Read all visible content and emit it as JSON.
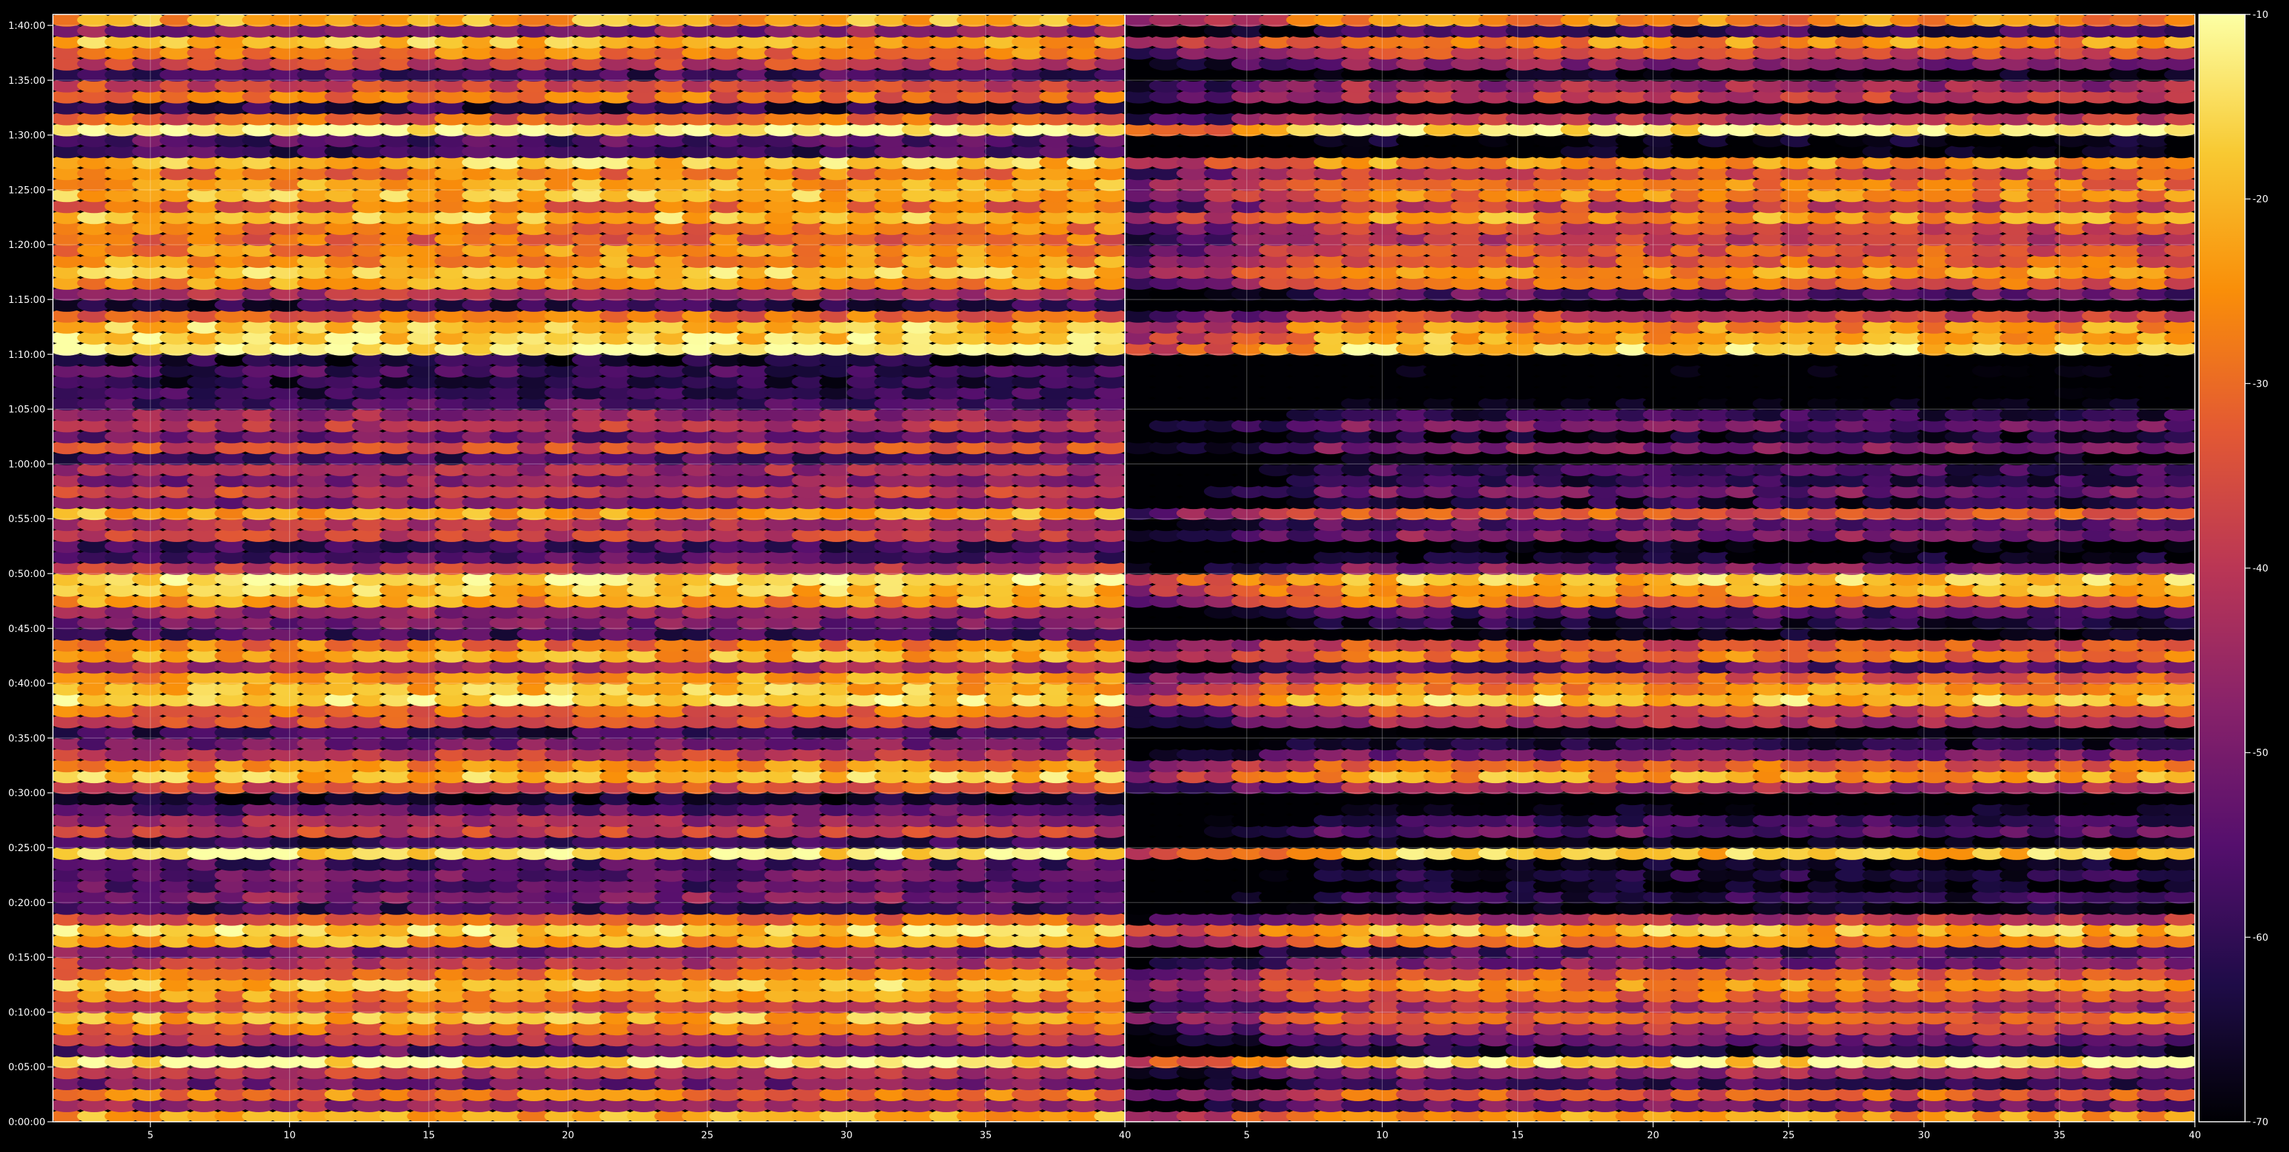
{
  "chart_data": {
    "type": "heatmap",
    "title": "",
    "xlabel": "",
    "ylabel": "",
    "panels": [
      {
        "name": "",
        "x_range": [
          1.5,
          40
        ],
        "x_ticks": [
          5,
          10,
          15,
          20,
          25,
          30,
          35,
          40
        ],
        "bins": 39
      },
      {
        "name": "",
        "x_range": [
          0.5,
          40
        ],
        "x_ticks": [
          5,
          10,
          15,
          20,
          25,
          30,
          35,
          40
        ],
        "bins": 39
      }
    ],
    "y_ticks": [
      "0:00:00",
      "0:05:00",
      "0:10:00",
      "0:15:00",
      "0:20:00",
      "0:25:00",
      "0:30:00",
      "0:35:00",
      "0:40:00",
      "0:45:00",
      "0:50:00",
      "0:55:00",
      "1:00:00",
      "1:05:00",
      "1:10:00",
      "1:15:00",
      "1:20:00",
      "1:25:00",
      "1:30:00",
      "1:35:00",
      "1:40:00"
    ],
    "y_range_minutes": [
      0,
      101
    ],
    "rows": 101,
    "colorbar": {
      "colormap": "inferno",
      "ticks": [
        -10,
        -20,
        -30,
        -40,
        -50,
        -60,
        -70
      ],
      "range": [
        -70,
        -10
      ]
    },
    "row_profile_db": [
      -22,
      -45,
      -28,
      -50,
      -40,
      -12,
      -55,
      -42,
      -30,
      -20,
      -35,
      -25,
      -18,
      -28,
      -40,
      -50,
      -22,
      -16,
      -32,
      -58,
      -48,
      -55,
      -52,
      -56,
      -14,
      -60,
      -38,
      -45,
      -55,
      -66,
      -36,
      -18,
      -26,
      -40,
      -50,
      -60,
      -34,
      -30,
      -14,
      -20,
      -24,
      -44,
      -22,
      -28,
      -58,
      -50,
      -45,
      -24,
      -18,
      -14,
      -40,
      -55,
      -58,
      -38,
      -42,
      -22,
      -48,
      -38,
      -48,
      -44,
      -58,
      -36,
      -52,
      -40,
      -46,
      -56,
      -60,
      -62,
      -58,
      -64,
      -12,
      -16,
      -18,
      -30,
      -62,
      -42,
      -24,
      -18,
      -24,
      -26,
      -30,
      -28,
      -18,
      -30,
      -20,
      -22,
      -28,
      -18,
      -58,
      -56,
      -10,
      -32,
      -62,
      -30,
      -36,
      -58,
      -38,
      -28,
      -20,
      -48,
      -22
    ],
    "panel2_row_offset_db": [
      -6,
      -12,
      -8,
      -14,
      -10,
      -4,
      -14,
      -18,
      -20,
      -18,
      -16,
      -12,
      -14,
      -10,
      -16,
      -14,
      -8,
      -6,
      -16,
      -20,
      -24,
      -24,
      -20,
      -20,
      -8,
      -22,
      -28,
      -26,
      -28,
      -24,
      -14,
      -8,
      -10,
      -20,
      -24,
      -26,
      -18,
      -12,
      -6,
      -8,
      -16,
      -18,
      -10,
      -12,
      -22,
      -24,
      -20,
      -10,
      -8,
      -6,
      -18,
      -24,
      -22,
      -20,
      -22,
      -20,
      -26,
      -24,
      -22,
      -26,
      -26,
      -22,
      -24,
      -20,
      -26,
      -28,
      -28,
      -28,
      -28,
      -28,
      -8,
      -10,
      -12,
      -16,
      -26,
      -22,
      -14,
      -10,
      -14,
      -14,
      -16,
      -14,
      -10,
      -14,
      -12,
      -12,
      -14,
      -10,
      -24,
      -24,
      -6,
      -16,
      -26,
      -18,
      -16,
      -24,
      -18,
      -14,
      -10,
      -20,
      -8
    ],
    "panel2_early_columns_extra_db": -22
  }
}
